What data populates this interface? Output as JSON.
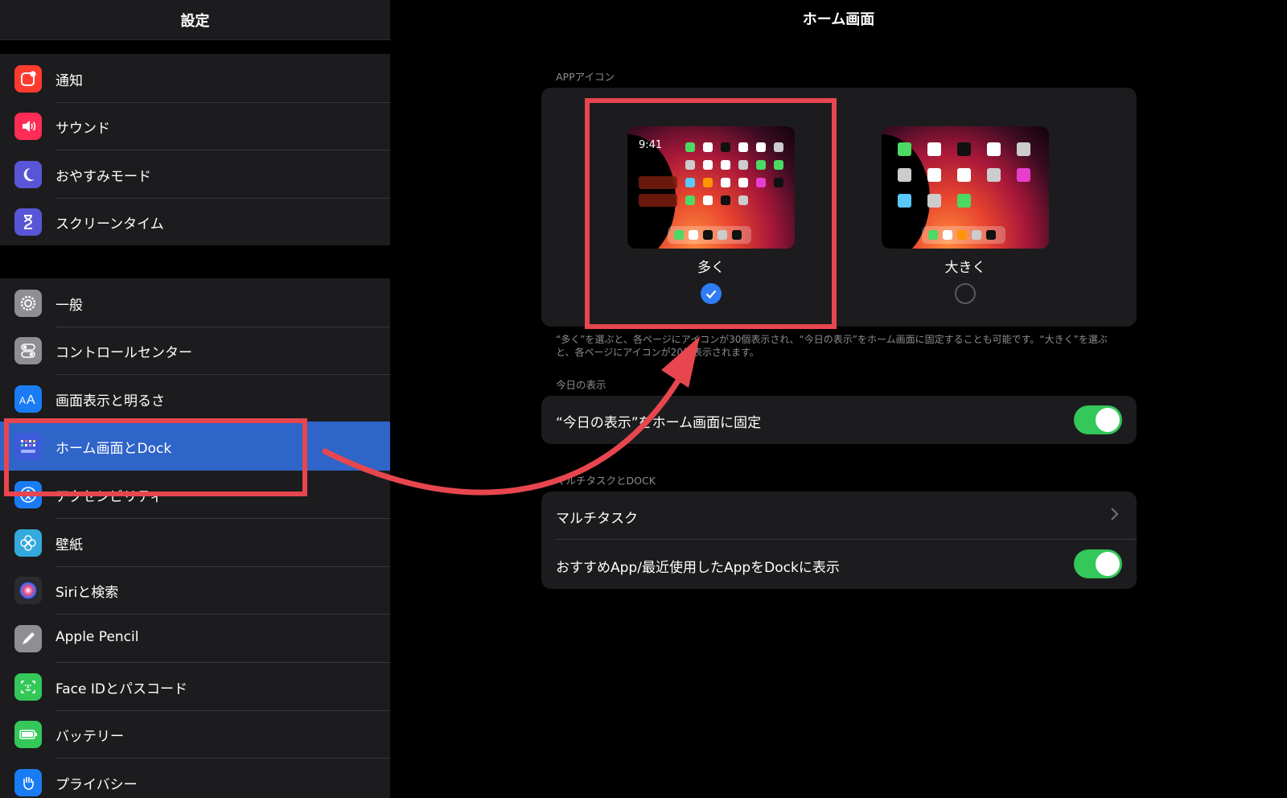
{
  "sidebar": {
    "title": "設定",
    "group1": [
      {
        "label": "通知",
        "icon": "notifications-icon",
        "color": "#ff3b30"
      },
      {
        "label": "サウンド",
        "icon": "speaker-icon",
        "color": "#ff2d55"
      },
      {
        "label": "おやすみモード",
        "icon": "moon-icon",
        "color": "#5856d6"
      },
      {
        "label": "スクリーンタイム",
        "icon": "hourglass-icon",
        "color": "#5856d6"
      }
    ],
    "group2": [
      {
        "label": "一般",
        "icon": "gear-icon",
        "color": "#8e8e93"
      },
      {
        "label": "コントロールセンター",
        "icon": "toggles-icon",
        "color": "#8e8e93"
      },
      {
        "label": "画面表示と明るさ",
        "icon": "text-size-icon",
        "color": "#1a7cf5"
      },
      {
        "label": "ホーム画面とDock",
        "icon": "home-grid-icon",
        "color": "#3b5bdb",
        "selected": true
      },
      {
        "label": "アクセシビリティ",
        "icon": "accessibility-icon",
        "color": "#1a7cf5"
      },
      {
        "label": "壁紙",
        "icon": "flower-icon",
        "color": "#34aadc"
      },
      {
        "label": "Siriと検索",
        "icon": "siri-icon",
        "color": "#2c2c2e"
      },
      {
        "label": "Apple Pencil",
        "icon": "pencil-icon",
        "color": "#8e8e93"
      },
      {
        "label": "Face IDとパスコード",
        "icon": "faceid-icon",
        "color": "#34c759"
      },
      {
        "label": "バッテリー",
        "icon": "battery-icon",
        "color": "#34c759"
      },
      {
        "label": "プライバシー",
        "icon": "hand-icon",
        "color": "#1a7cf5"
      }
    ]
  },
  "main": {
    "title": "ホーム画面",
    "app_icon_section": "APPアイコン",
    "preview_time": "9:41",
    "option_more": "多く",
    "option_bigger": "大きく",
    "selected_option": "多く",
    "footnote": "“多く”を選ぶと、各ページにアイコンが30個表示され、“今日の表示”をホーム画面に固定することも可能です。“大きく”を選ぶと、各ページにアイコンが20個表示されます。",
    "today_section": "今日の表示",
    "today_pin_label": "“今日の表示”をホーム画面に固定",
    "today_pin_on": true,
    "multitask_section": "マルチタスクとDOCK",
    "multitask_label": "マルチタスク",
    "dock_suggest_label": "おすすめApp/最近使用したAppをDockに表示",
    "dock_suggest_on": true
  },
  "colors": {
    "accent": "#2f7cf6",
    "selected_row": "#2f64c8",
    "toggle_on": "#34c759",
    "annotation": "#e8464f"
  }
}
